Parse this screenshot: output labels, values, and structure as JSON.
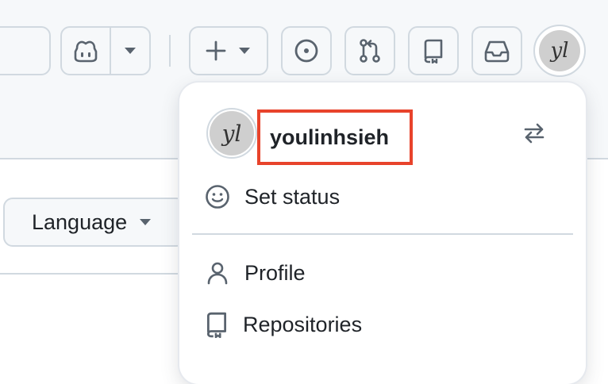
{
  "header": {
    "copilot": {
      "icon": "copilot-icon",
      "dropdown_icon": "triangle-down-icon"
    },
    "create": {
      "icon": "plus-icon",
      "dropdown_icon": "triangle-down-icon"
    },
    "issues": {
      "icon": "issue-opened-icon"
    },
    "pull_requests": {
      "icon": "git-pull-request-icon"
    },
    "repositories": {
      "icon": "repo-icon"
    },
    "inbox": {
      "icon": "inbox-icon"
    },
    "avatar": {
      "text": "yl"
    }
  },
  "content": {
    "language_button": {
      "label": "Language",
      "icon": "triangle-down-icon"
    }
  },
  "user_menu": {
    "avatar_text": "yl",
    "username": "youlinhsieh",
    "switch_account_icon": "arrow-switch-icon",
    "highlight_color": "#e8432b",
    "items": [
      {
        "label": "Set status",
        "icon": "smiley-icon"
      },
      {
        "label": "Profile",
        "icon": "person-icon"
      },
      {
        "label": "Repositories",
        "icon": "repo-icon"
      }
    ]
  }
}
